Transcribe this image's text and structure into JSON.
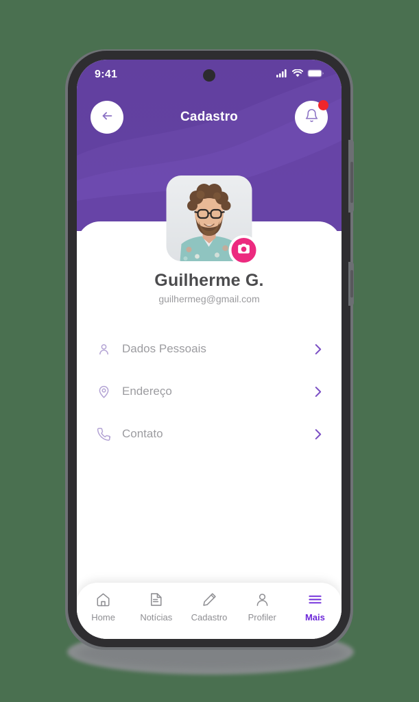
{
  "theme": {
    "header_purple": "#62409f",
    "accent_pink": "#ec2a7f",
    "active_purple": "#6d28d9",
    "icon_purple": "#b3a3d4",
    "badge_red": "#f0262b",
    "page_background": "#4a7050"
  },
  "status_bar": {
    "time": "9:41",
    "signal_icon": "cellular-signal-icon",
    "wifi_icon": "wifi-icon",
    "battery_icon": "battery-icon"
  },
  "header": {
    "title": "Cadastro",
    "back_icon": "arrow-left-icon",
    "bell_icon": "bell-icon",
    "has_notification_badge": true
  },
  "profile": {
    "name": "Guilherme G.",
    "email": "guilhermeg@gmail.com",
    "avatar_alt": "user-avatar-photo",
    "camera_icon": "camera-icon"
  },
  "menu": {
    "items": [
      {
        "label": "Dados Pessoais",
        "icon": "person-icon",
        "chevron": "chevron-right-icon"
      },
      {
        "label": "Endereço",
        "icon": "location-pin-icon",
        "chevron": "chevron-right-icon"
      },
      {
        "label": "Contato",
        "icon": "phone-icon",
        "chevron": "chevron-right-icon"
      }
    ]
  },
  "bottom_nav": {
    "items": [
      {
        "label": "Home",
        "icon": "home-icon",
        "active": false
      },
      {
        "label": "Notícias",
        "icon": "document-icon",
        "active": false
      },
      {
        "label": "Cadastro",
        "icon": "pencil-icon",
        "active": false
      },
      {
        "label": "Profiler",
        "icon": "person-icon",
        "active": false
      },
      {
        "label": "Mais",
        "icon": "hamburger-menu-icon",
        "active": true
      }
    ]
  }
}
